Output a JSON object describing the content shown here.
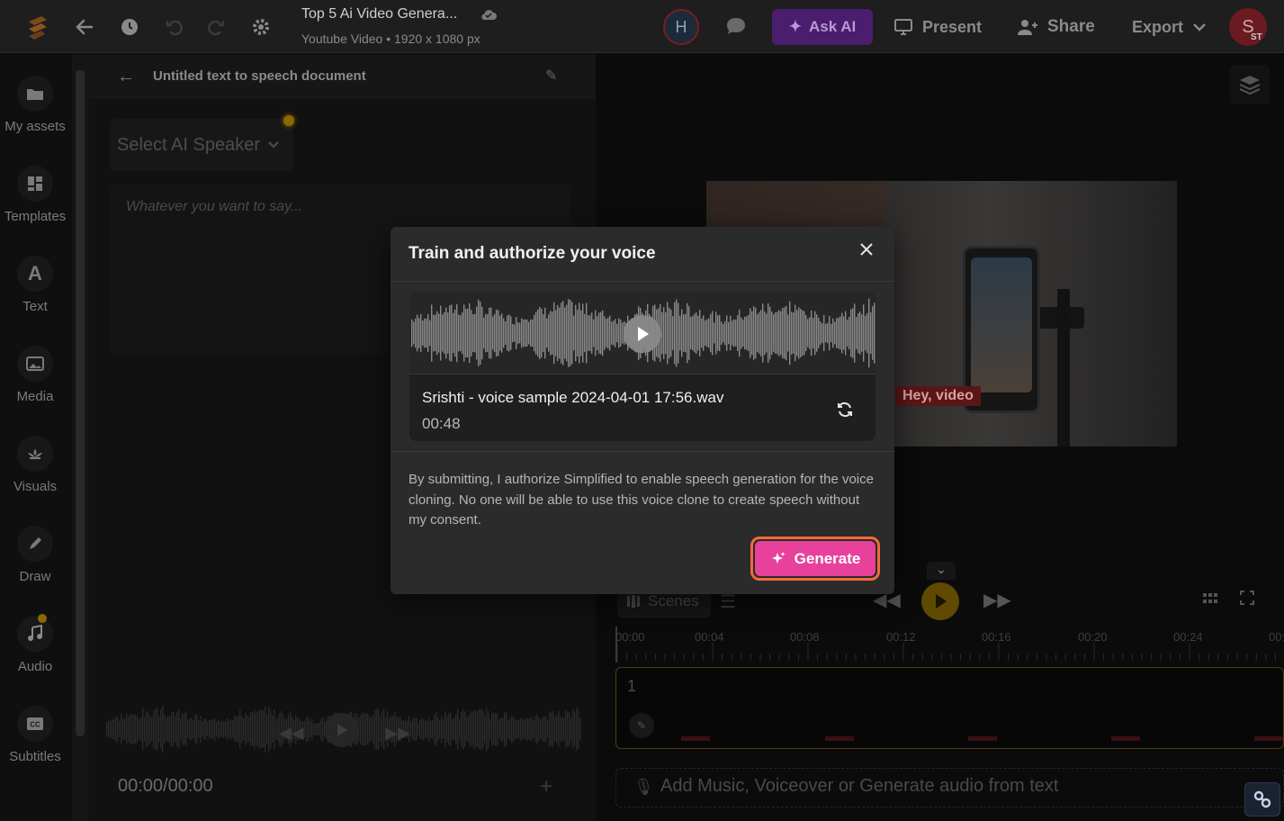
{
  "header": {
    "doc_title": "Top 5 Ai Video Genera...",
    "doc_subtitle": "Youtube Video • 1920 x 1080 px",
    "collaborator_initial": "H",
    "ask_ai_label": "Ask AI",
    "present_label": "Present",
    "share_label": "Share",
    "export_label": "Export",
    "user_initial": "S",
    "user_badge": "ST"
  },
  "sidebar": {
    "items": [
      {
        "label": "My assets",
        "icon": "folder-icon"
      },
      {
        "label": "Templates",
        "icon": "templates-icon"
      },
      {
        "label": "Text",
        "icon": "text-icon"
      },
      {
        "label": "Media",
        "icon": "image-icon"
      },
      {
        "label": "Visuals",
        "icon": "visuals-icon"
      },
      {
        "label": "Draw",
        "icon": "pen-icon"
      },
      {
        "label": "Audio",
        "icon": "music-icon"
      },
      {
        "label": "Subtitles",
        "icon": "cc-icon"
      }
    ]
  },
  "tts_panel": {
    "title": "Untitled text to speech document",
    "speaker_placeholder": "Select AI Speaker",
    "text_placeholder": "Whatever you want to say...",
    "time": "00:00/00:00"
  },
  "canvas": {
    "caption_text": "Hey, video"
  },
  "timeline": {
    "scenes_label": "Scenes",
    "ticks": [
      "00:00",
      "00:04",
      "00:08",
      "00:12",
      "00:16",
      "00:20",
      "00:24",
      "00:"
    ],
    "scene_number": "1",
    "audio_track_label": "Add Music, Voiceover or Generate audio from text"
  },
  "modal": {
    "title": "Train and authorize your voice",
    "sample_filename": "Srishti - voice sample 2024-04-01 17:56.wav",
    "sample_duration": "00:48",
    "consent_text": "By submitting, I authorize Simplified to enable speech generation for the voice cloning. No one will be able to use this voice clone to create speech without my consent.",
    "generate_label": "Generate"
  },
  "colors": {
    "accent_pink": "#e8419b",
    "focus_ring": "#f06a3a",
    "modal_bg": "#2b2b2b",
    "ask_ai_purple": "#4a1d6e"
  }
}
